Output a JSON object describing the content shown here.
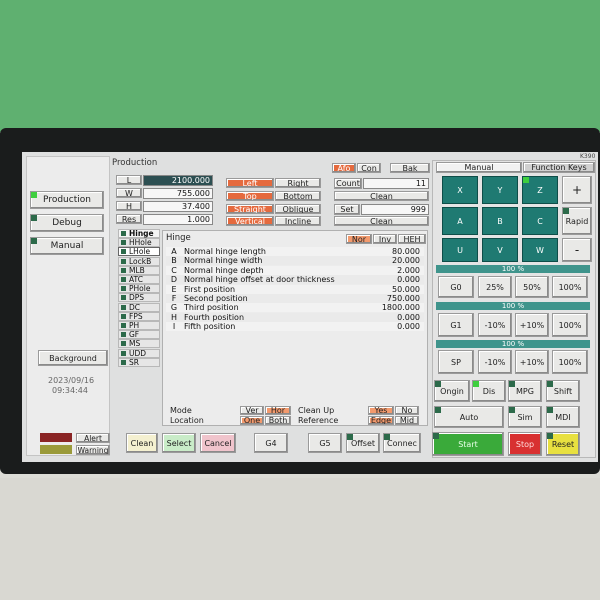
{
  "screen_label": "K390",
  "left_panel": {
    "production_label": "Production",
    "debug_label": "Debug",
    "manual_label": "Manual",
    "background_label": "Background",
    "date": "2023/09/16",
    "time": "09:34:44",
    "alert_label": "Alert",
    "warning_label": "Warning"
  },
  "production_header": "Production",
  "dims": {
    "L_label": "L",
    "L": "2100.000",
    "W_label": "W",
    "W": "755.000",
    "H_label": "H",
    "H": "37.400",
    "Res_label": "Res",
    "Res": "1.000"
  },
  "opts": {
    "left": "Left",
    "right": "Right",
    "top": "Top",
    "bottom": "Bottom",
    "straight": "Straight",
    "oblique": "Oblique",
    "vertical": "Vertical",
    "incline": "Incline"
  },
  "top_right": {
    "afo": "Afo",
    "con": "Con",
    "bak": "Bak",
    "count_label": "Count",
    "count": "11",
    "clean1": "Clean",
    "set_label": "Set",
    "set": "999",
    "clean2": "Clean"
  },
  "sidebar_list": [
    "Hinge",
    "HHole",
    "LHole",
    "LockB",
    "MLB",
    "ATC",
    "PHole",
    "DPS",
    "DC",
    "FPS",
    "PH",
    "GF",
    "MS",
    "UDD",
    "SR"
  ],
  "hinge": {
    "title": "Hinge",
    "nor": "Nor",
    "inv": "Inv",
    "heh": "HEH",
    "rows": [
      {
        "key": "A",
        "name": "Normal hinge length",
        "value": "80.000"
      },
      {
        "key": "B",
        "name": "Normal hinge width",
        "value": "20.000"
      },
      {
        "key": "C",
        "name": "Normal hinge depth",
        "value": "2.000"
      },
      {
        "key": "D",
        "name": "Normal hinge offset at door thickness",
        "value": "0.000"
      },
      {
        "key": "E",
        "name": "First position",
        "value": "50.000"
      },
      {
        "key": "F",
        "name": "Second position",
        "value": "750.000"
      },
      {
        "key": "G",
        "name": "Third position",
        "value": "1800.000"
      },
      {
        "key": "H",
        "name": "Fourth position",
        "value": "0.000"
      },
      {
        "key": "I",
        "name": "Fifth position",
        "value": "0.000"
      }
    ],
    "mode_label": "Mode",
    "ver": "Ver",
    "hor": "Hor",
    "cleanup_label": "Clean Up",
    "yes": "Yes",
    "no": "No",
    "location_label": "Location",
    "one": "One",
    "both": "Both",
    "reference_label": "Reference",
    "edge": "Edge",
    "mid": "Mid"
  },
  "bottom_bar": {
    "clean": "Clean",
    "select": "Select",
    "cancel": "Cancel",
    "g4": "G4",
    "g5": "G5",
    "offset": "Offset",
    "connect": "Connec"
  },
  "right_panel": {
    "tab_manual": "Manual",
    "tab_function": "Function Keys",
    "x": "X",
    "y": "Y",
    "z": "Z",
    "plus": "+",
    "a": "A",
    "b": "B",
    "c": "C",
    "rapid": "Rapid",
    "u": "U",
    "v": "V",
    "w": "W",
    "minus": "-",
    "pct1": "100 %",
    "pct2": "100 %",
    "pct3": "100 %",
    "g0": "G0",
    "p25": "25%",
    "p50": "50%",
    "p100a": "100%",
    "g1": "G1",
    "m10a": "-10%",
    "p10a": "+10%",
    "p100b": "100%",
    "sp": "SP",
    "m10b": "-10%",
    "p10b": "+10%",
    "p100c": "100%",
    "origin": "Ongin",
    "dis": "Dis",
    "mpg": "MPG",
    "shift": "Shift",
    "auto": "Auto",
    "sim": "Sim",
    "mdi": "MDI",
    "start": "Start",
    "stop": "Stop",
    "reset": "Reset"
  },
  "colors": {
    "accent_orange": "#e56a3e",
    "teal": "#1f7a72",
    "start_green": "#3aaa3a",
    "stop_red": "#d83030",
    "reset_yellow": "#e8e040"
  }
}
